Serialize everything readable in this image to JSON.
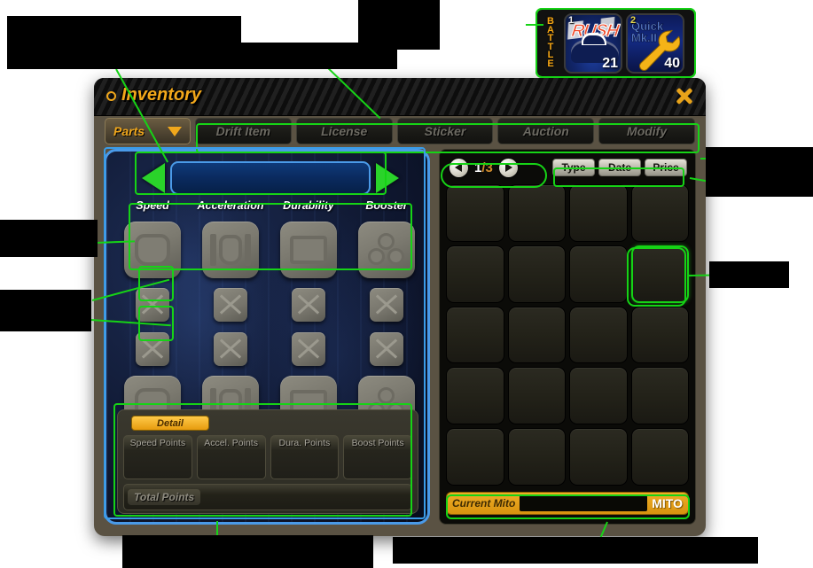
{
  "hud": {
    "mode_label": "BATTLE",
    "cards": [
      {
        "index": "1",
        "title": "RUSH",
        "subtitle": "",
        "count": "21",
        "icon": "car-icon"
      },
      {
        "index": "2",
        "title": "Quick",
        "subtitle": "Mk.II",
        "count": "40",
        "icon": "wrench-icon"
      }
    ]
  },
  "window": {
    "title": "Inventory",
    "close_label": "×"
  },
  "tabs": [
    {
      "label": "Parts",
      "active": true
    },
    {
      "label": "Drift Item",
      "active": false
    },
    {
      "label": "License",
      "active": false
    },
    {
      "label": "Sticker",
      "active": false
    },
    {
      "label": "Auction",
      "active": false
    },
    {
      "label": "Modify",
      "active": false
    }
  ],
  "equip": {
    "selected_part_name": "",
    "prev_label": "◀",
    "next_label": "▶",
    "columns": [
      "Speed",
      "Acceleration",
      "Durability",
      "Booster"
    ],
    "rows": [
      {
        "type": "big",
        "cells": [
          "speed-slot-icon",
          "acceleration-slot-icon",
          "durability-slot-icon",
          "booster-slot-icon"
        ]
      },
      {
        "type": "small",
        "cells": [
          "locked-slot",
          "locked-slot",
          "locked-slot",
          "locked-slot"
        ]
      },
      {
        "type": "small",
        "cells": [
          "locked-slot",
          "locked-slot",
          "locked-slot",
          "locked-slot"
        ]
      },
      {
        "type": "big",
        "cells": [
          "speed-slot-icon",
          "acceleration-slot-icon",
          "durability-slot-icon",
          "booster-slot-icon"
        ]
      }
    ]
  },
  "detail": {
    "tab_label": "Detail",
    "stats": [
      {
        "label": "Speed Points",
        "value": ""
      },
      {
        "label": "Accel. Points",
        "value": ""
      },
      {
        "label": "Dura. Points",
        "value": ""
      },
      {
        "label": "Boost Points",
        "value": ""
      }
    ],
    "total_label": "Total Points",
    "total_value": ""
  },
  "inventory": {
    "page_current": "1",
    "page_sep": "/",
    "page_total": "3",
    "prev_label": "◀",
    "next_label": "▶",
    "sort_buttons": [
      "Type",
      "Date",
      "Price"
    ],
    "columns": 4,
    "rows": 5,
    "selected_index": 7,
    "cells": [
      "",
      "",
      "",
      "",
      "",
      "",
      "",
      "",
      "",
      "",
      "",
      "",
      "",
      "",
      "",
      "",
      "",
      "",
      "",
      ""
    ]
  },
  "currency": {
    "label": "Current Mito",
    "value": "",
    "unit": "MITO"
  },
  "colors": {
    "accent_gold": "#f3a81a",
    "annotation_green": "#16d316",
    "panel_blue_border": "#4a9ae8",
    "window_frame": "#5a5243"
  }
}
